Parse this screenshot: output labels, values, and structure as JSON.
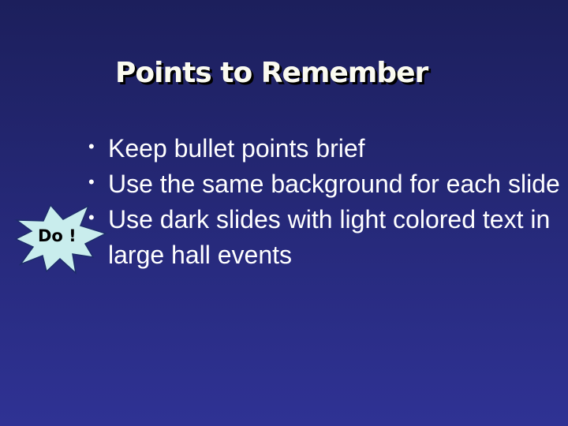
{
  "slide": {
    "title": "Points to Remember",
    "bullets": [
      "Keep bullet points brief",
      "Use the same background for each slide",
      "Use dark slides with light colored text in large hall events"
    ],
    "bullet_symbol": "•",
    "callout": {
      "label": "Do !",
      "shape": "starburst",
      "fill_color": "#c9eded"
    },
    "colors": {
      "background_top": "#1c1f5c",
      "background_bottom": "#2f3294",
      "title_text": "#fafaf0",
      "body_text": "#ffffff"
    }
  }
}
